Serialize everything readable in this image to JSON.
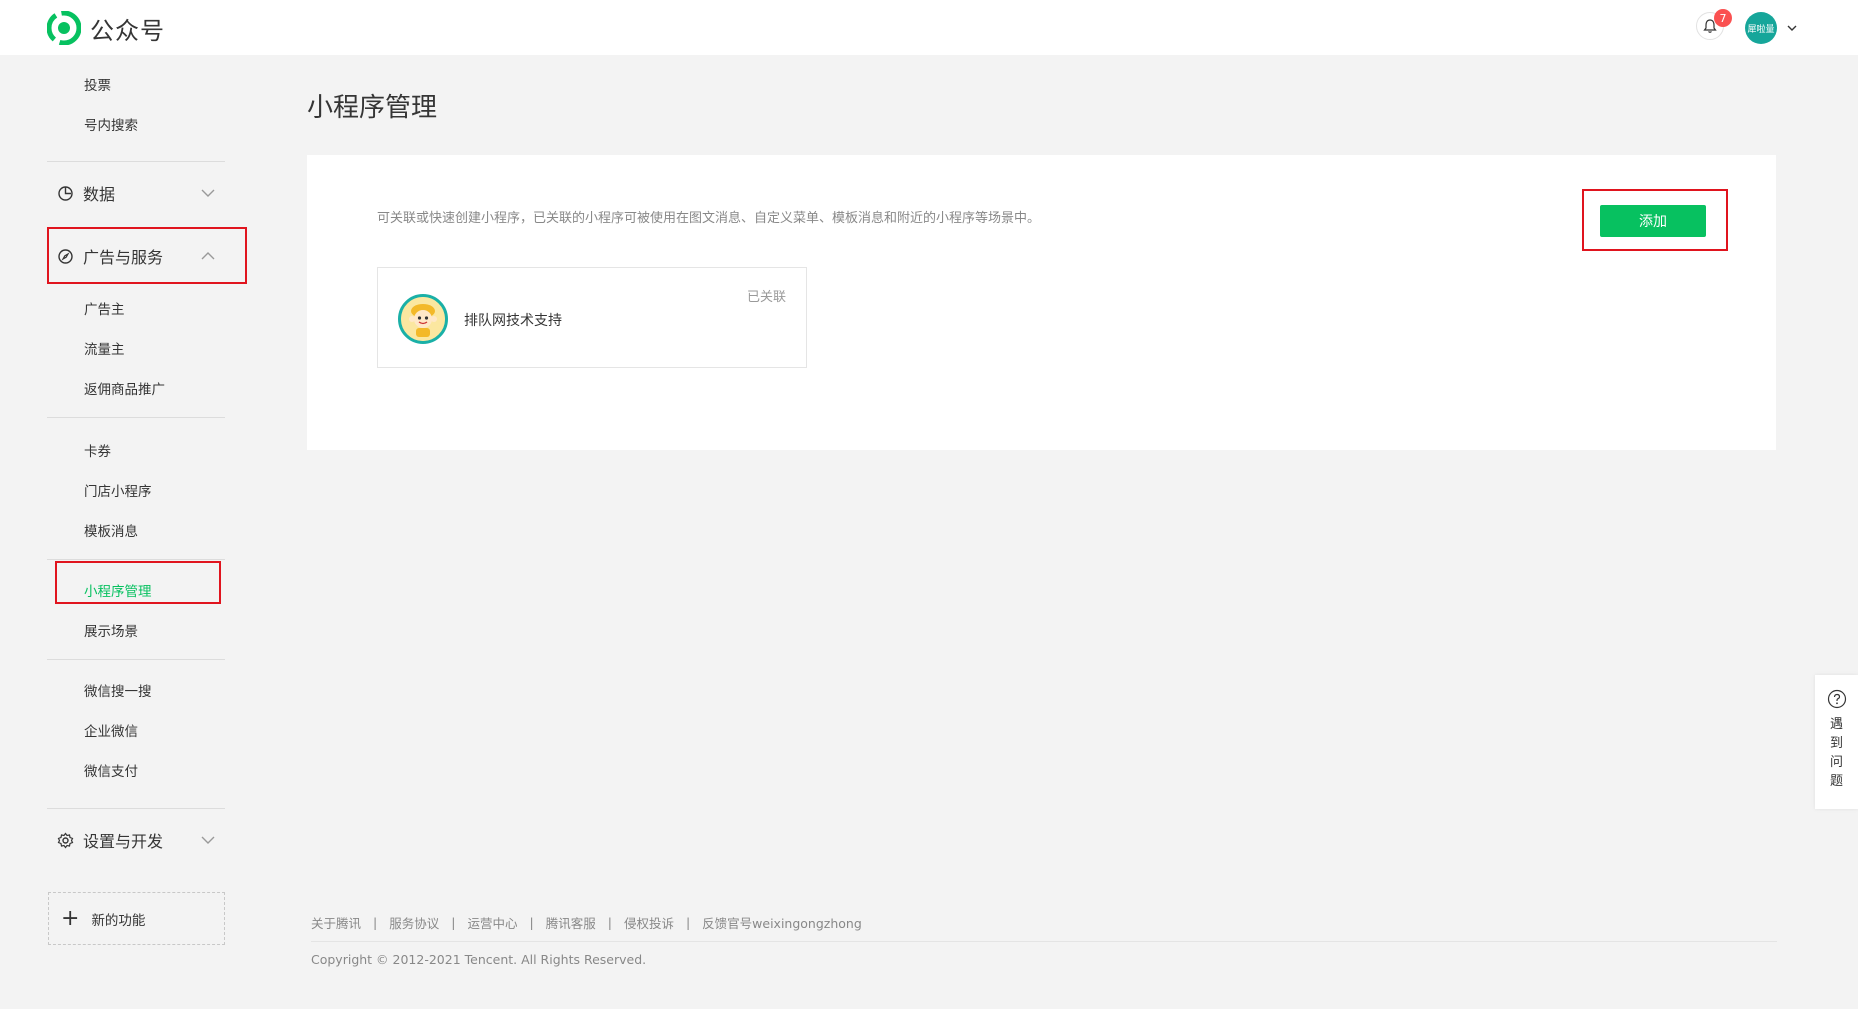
{
  "header": {
    "logo_text": "公众号",
    "notification_count": "7",
    "avatar_text": "犀啦量"
  },
  "sidebar": {
    "top_items": [
      "投票",
      "号内搜索"
    ],
    "groups": {
      "data": "数据",
      "ads": "广告与服务",
      "settings": "设置与开发"
    },
    "ads_items_1": [
      "广告主",
      "流量主",
      "返佣商品推广"
    ],
    "ads_items_2": [
      "卡券",
      "门店小程序",
      "模板消息"
    ],
    "ads_items_3": [
      "小程序管理",
      "展示场景"
    ],
    "ads_items_4": [
      "微信搜一搜",
      "企业微信",
      "微信支付"
    ],
    "new_feature": "新的功能"
  },
  "main": {
    "title": "小程序管理",
    "description": "可关联或快速创建小程序，已关联的小程序可被使用在图文消息、自定义菜单、模板消息和附近的小程序等场景中。",
    "add_button": "添加",
    "card": {
      "name": "排队网技术支持",
      "status": "已关联"
    }
  },
  "footer": {
    "links": [
      "关于腾讯",
      "服务协议",
      "运营中心",
      "腾讯客服",
      "侵权投诉",
      "反馈官号weixingongzhong"
    ],
    "separator": "|",
    "copyright": "Copyright © 2012-2021 Tencent. All Rights Reserved."
  },
  "help": {
    "text": "遇到问题"
  },
  "colors": {
    "accent": "#07c160",
    "highlight_box": "#e0141e",
    "badge": "#fa5151"
  }
}
